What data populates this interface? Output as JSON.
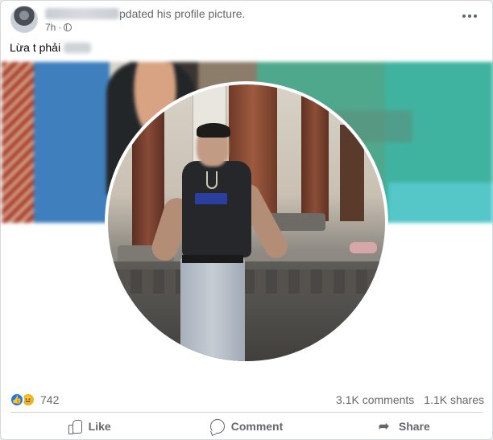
{
  "post": {
    "author_suffix": "pdated his profile picture.",
    "time": "7h",
    "time_separator": "·",
    "caption": "Lừa t phải"
  },
  "stats": {
    "reaction_count": "742",
    "comments": "3.1K comments",
    "shares": "1.1K shares"
  },
  "actions": {
    "like": "Like",
    "comment": "Comment",
    "share": "Share"
  },
  "icons": [
    "globe-icon",
    "more-options-icon",
    "like-reaction-icon",
    "haha-reaction-icon",
    "like-icon",
    "comment-icon",
    "share-icon"
  ],
  "colors": {
    "like_blue": "#1877f2",
    "haha_yellow": "#f7b125",
    "secondary_text": "#65676b"
  }
}
